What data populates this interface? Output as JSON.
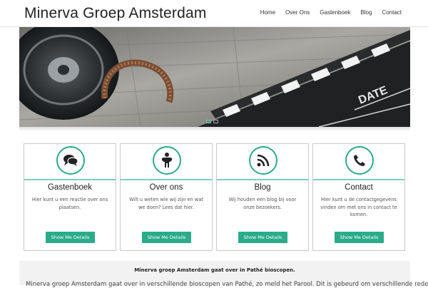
{
  "header": {
    "site_title": "Minerva Groep Amsterdam",
    "nav": [
      "Home",
      "Over Ons",
      "Gastenboek",
      "Blog",
      "Contact"
    ]
  },
  "slider": {
    "slide_count": 2,
    "active_index": 0
  },
  "cards": [
    {
      "icon": "chat-bubbles-icon",
      "title": "Gastenboek",
      "text": "Hier kunt u een reactie over ons plaatsen.",
      "button": "Show Me Details"
    },
    {
      "icon": "person-icon",
      "title": "Over ons",
      "text": "Wilt u weten wie wij zijn en wat we doen? Lees dat hier.",
      "button": "Show Me Details"
    },
    {
      "icon": "rss-icon",
      "title": "Blog",
      "text": "Wij houden een blog bij voor onze bezoekers.",
      "button": "Show Me Details"
    },
    {
      "icon": "phone-icon",
      "title": "Contact",
      "text": "Hier kunt u de contactgegevens vinden om met ons in contact te komen.",
      "button": "Show Me Details"
    }
  ],
  "intro": {
    "title": "Minerva groep Amsterdam gaat over in Pathé bioscopen.",
    "text": "Minerva groep Amsterdam gaat over in verschillende bioscopen van Pathé, zo meld het Parool. Dit is gebeurd om verschillende redenen"
  },
  "colors": {
    "accent": "#2aab8a",
    "accent_light": "#7ccfbb"
  }
}
